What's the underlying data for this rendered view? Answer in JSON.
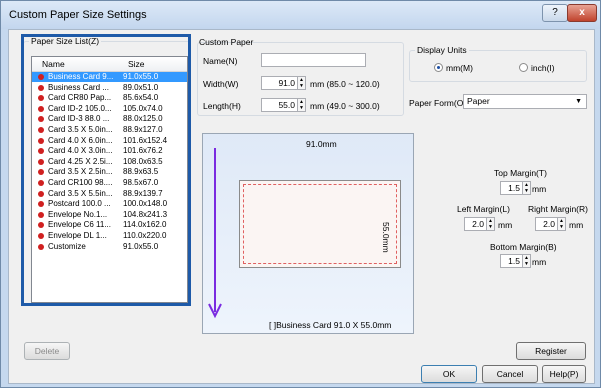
{
  "window": {
    "title": "Custom Paper Size Settings",
    "help_glyph": "?",
    "close_glyph": "x"
  },
  "paper_list": {
    "group_label": "Paper Size List(Z)",
    "columns": {
      "name": "Name",
      "size": "Size"
    },
    "items": [
      {
        "name": "Business Card 9...",
        "size": "91.0x55.0"
      },
      {
        "name": "Business Card ...",
        "size": "89.0x51.0"
      },
      {
        "name": "Card CR80 Pap...",
        "size": "85.6x54.0"
      },
      {
        "name": "Card ID-2 105.0...",
        "size": "105.0x74.0"
      },
      {
        "name": "Card ID-3 88.0 ...",
        "size": "88.0x125.0"
      },
      {
        "name": "Card 3.5 X 5.0in...",
        "size": "88.9x127.0"
      },
      {
        "name": "Card 4.0 X 6.0in...",
        "size": "101.6x152.4"
      },
      {
        "name": "Card 4.0 X 3.0in...",
        "size": "101.6x76.2"
      },
      {
        "name": "Card 4.25 X 2.5i...",
        "size": "108.0x63.5"
      },
      {
        "name": "Card 3.5 X 2.5in...",
        "size": "88.9x63.5"
      },
      {
        "name": "Card CR100 98....",
        "size": "98.5x67.0"
      },
      {
        "name": "Card 3.5 X 5.5in...",
        "size": "88.9x139.7"
      },
      {
        "name": "Postcard 100.0 ...",
        "size": "100.0x148.0"
      },
      {
        "name": "Envelope No.1...",
        "size": "104.8x241.3"
      },
      {
        "name": "Envelope C6 11...",
        "size": "114.0x162.0"
      },
      {
        "name": "Envelope DL 1...",
        "size": "110.0x220.0"
      },
      {
        "name": "Customize",
        "size": "91.0x55.0"
      }
    ],
    "selected_index": 0
  },
  "custom_paper": {
    "group_label": "Custom Paper",
    "name_label": "Name(N)",
    "name_value": "",
    "width_label": "Width(W)",
    "width_value": "91.0",
    "width_range": "mm (85.0 ~ 120.0)",
    "length_label": "Length(H)",
    "length_value": "55.0",
    "length_range": "mm (49.0 ~ 300.0)"
  },
  "display_units": {
    "group_label": "Display Units",
    "mm_label": "mm(M)",
    "inch_label": "inch(I)",
    "selected": "mm"
  },
  "paper_form": {
    "label": "Paper Form(O)",
    "value": "Paper"
  },
  "preview": {
    "width_text": "91.0mm",
    "height_text": "55.0mm",
    "caption": "[ ]Business Card 91.0 X 55.0mm"
  },
  "margins": {
    "top_label": "Top Margin(T)",
    "top_value": "1.5",
    "left_label": "Left Margin(L)",
    "left_value": "2.0",
    "right_label": "Right Margin(R)",
    "right_value": "2.0",
    "bottom_label": "Bottom Margin(B)",
    "bottom_value": "1.5",
    "unit": "mm"
  },
  "buttons": {
    "delete": "Delete",
    "register": "Register",
    "ok": "OK",
    "cancel": "Cancel",
    "help": "Help(P)"
  },
  "colors": {
    "highlight_box": "#1e5aa8",
    "selection": "#3399ff",
    "arrow": "#7a2be0"
  }
}
